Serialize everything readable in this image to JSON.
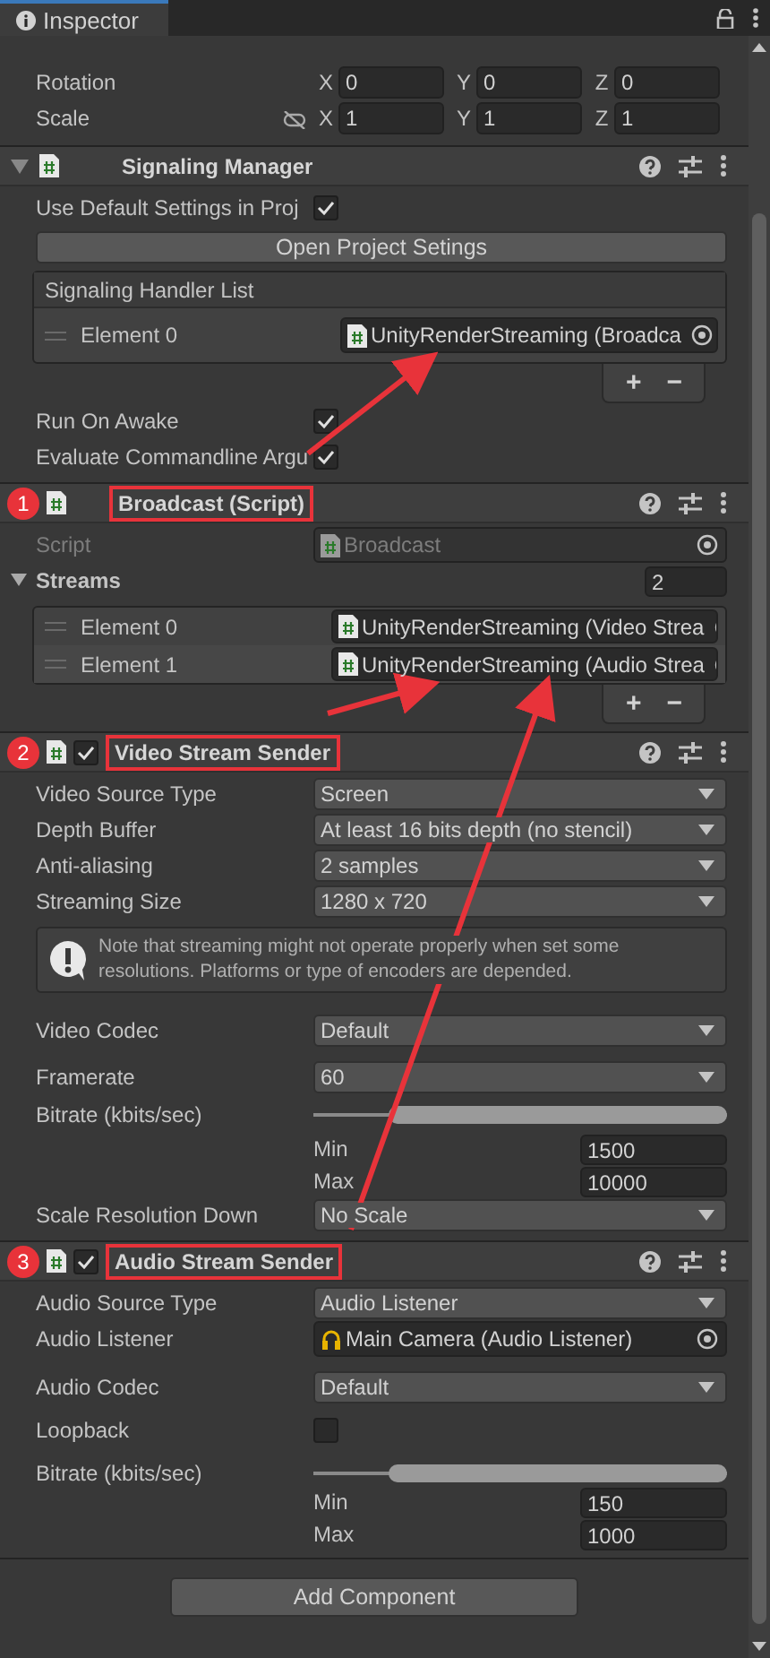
{
  "tab": {
    "label": "Inspector"
  },
  "transform": [
    {
      "kind": "rotation",
      "label": "Rotation",
      "axes": [
        {
          "axis": "X",
          "value": "0"
        },
        {
          "axis": "Y",
          "value": "0"
        },
        {
          "axis": "Z",
          "value": "0"
        }
      ]
    },
    {
      "kind": "scale",
      "label": "Scale",
      "axes": [
        {
          "axis": "X",
          "value": "1"
        },
        {
          "axis": "Y",
          "value": "1"
        },
        {
          "axis": "Z",
          "value": "1"
        }
      ]
    }
  ],
  "components": [
    {
      "title": "Signaling Manager",
      "expanded": true,
      "highlighted": false,
      "fields": [
        {
          "kind": "toggle",
          "label": "Use Default Settings in Proj",
          "checked": true
        },
        {
          "kind": "button",
          "label": "Open Project Setings"
        },
        {
          "kind": "list",
          "title": "Signaling Handler List",
          "elements": [
            {
              "label": "Element 0",
              "value": "UnityRenderStreaming (Broadca",
              "selected": false
            }
          ],
          "add": "+",
          "remove": "−"
        },
        {
          "kind": "toggle",
          "label": "Run On Awake",
          "checked": true
        },
        {
          "kind": "toggle",
          "label": "Evaluate Commandline Argu",
          "checked": true
        }
      ]
    },
    {
      "step": "1",
      "title": "Broadcast (Script)",
      "highlighted": true,
      "fields": [
        {
          "kind": "object",
          "label": "Script",
          "value": "Broadcast",
          "disabled": true
        },
        {
          "kind": "array",
          "label": "Streams",
          "count": "2",
          "expanded": true,
          "elements": [
            {
              "label": "Element 0",
              "value": "UnityRenderStreaming (Video Strea",
              "selected": false
            },
            {
              "label": "Element 1",
              "value": "UnityRenderStreaming (Audio Strea",
              "selected": true
            }
          ],
          "add": "+",
          "remove": "−"
        }
      ]
    },
    {
      "step": "2",
      "title": "Video Stream Sender",
      "enabled": true,
      "highlighted": true,
      "fields": [
        {
          "kind": "dropdown",
          "label": "Video Source Type",
          "value": "Screen"
        },
        {
          "kind": "dropdown",
          "label": "Depth Buffer",
          "value": "At least 16 bits depth (no stencil)"
        },
        {
          "kind": "dropdown",
          "label": "Anti-aliasing",
          "value": "2 samples"
        },
        {
          "kind": "dropdown",
          "label": "Streaming Size",
          "value": "1280 x 720"
        },
        {
          "kind": "help",
          "text": "Note that streaming might not operate properly when set some resolutions. Platforms or type of encoders are depended."
        },
        {
          "kind": "dropdown",
          "label": "Video Codec",
          "value": "Default",
          "spaced": true
        },
        {
          "kind": "dropdown",
          "label": "Framerate",
          "value": "60",
          "spaced": true
        },
        {
          "kind": "range",
          "label": "Bitrate (kbits/sec)",
          "level": 0.82,
          "min_label": "Min",
          "min": "1500",
          "max_label": "Max",
          "max": "10000"
        },
        {
          "kind": "dropdown",
          "label": "Scale Resolution Down",
          "value": "No Scale"
        }
      ]
    },
    {
      "step": "3",
      "title": "Audio Stream Sender",
      "enabled": true,
      "highlighted": true,
      "fields": [
        {
          "kind": "dropdown",
          "label": "Audio Source Type",
          "value": "Audio Listener"
        },
        {
          "kind": "object",
          "label": "Audio Listener",
          "value": "Main Camera (Audio Listener)",
          "disabled": false
        },
        {
          "kind": "dropdown",
          "label": "Audio Codec",
          "value": "Default",
          "spaced": true
        },
        {
          "kind": "toggle",
          "label": "Loopback",
          "checked": false,
          "spaced": true
        },
        {
          "kind": "range",
          "label": "Bitrate (kbits/sec)",
          "level": 0.82,
          "min_label": "Min",
          "min": "150",
          "max_label": "Max",
          "max": "1000",
          "spaced": true
        }
      ]
    }
  ],
  "add_component": "Add Component"
}
